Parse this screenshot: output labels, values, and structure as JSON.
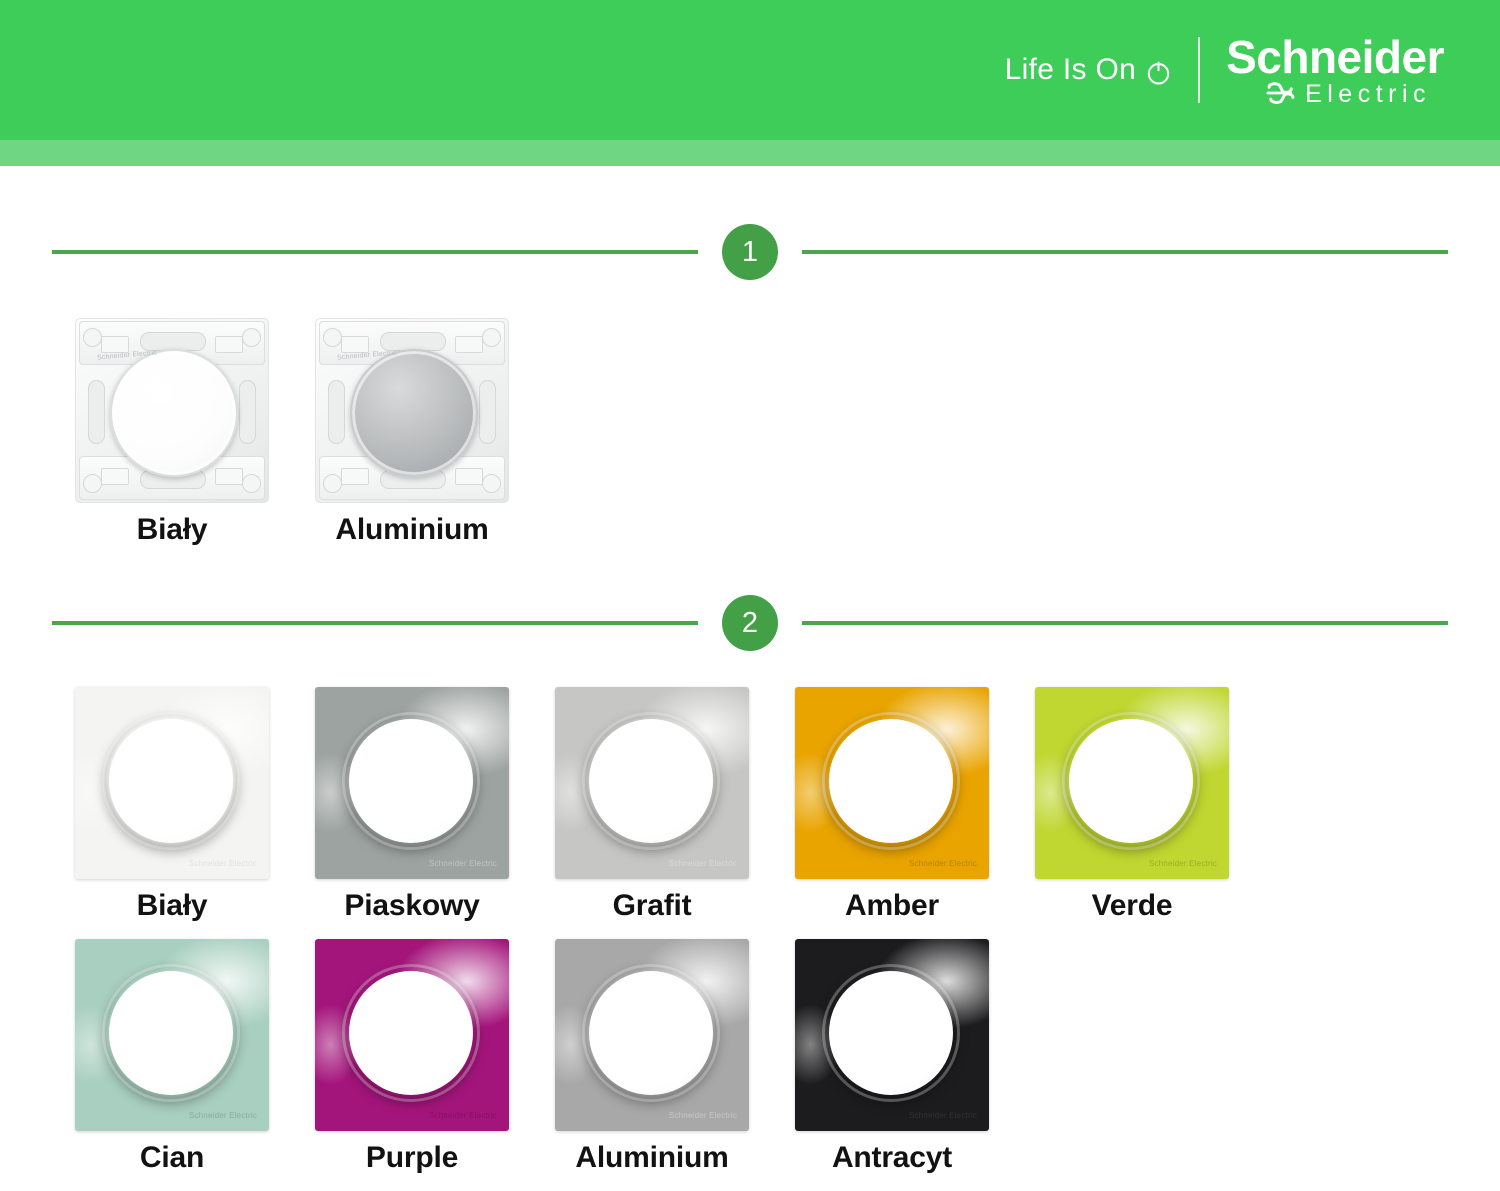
{
  "header": {
    "tagline": "Life Is On",
    "power_icon": "power-icon",
    "brand_name": "Schneider",
    "brand_sub": "Electric",
    "bg_color": "#3DCD58",
    "accent_color": "#6FD683"
  },
  "steps": [
    {
      "number": "1"
    },
    {
      "number": "2"
    }
  ],
  "section_one": {
    "items": [
      {
        "label": "Biały",
        "finish": "white",
        "brand_mark": "Schneider Electric"
      },
      {
        "label": "Aluminium",
        "finish": "alu",
        "brand_mark": "Schneider Electric"
      }
    ]
  },
  "section_two": {
    "items": [
      {
        "label": "Biały",
        "color": "#F4F4F2",
        "brand_color": "#c9cdc9",
        "brand_mark": "Schneider Electric"
      },
      {
        "label": "Piaskowy",
        "color": "#9DA3A1",
        "brand_color": "#e9eceb",
        "brand_mark": "Schneider Electric"
      },
      {
        "label": "Grafit",
        "color": "#C6C6C4",
        "brand_color": "#f0f1f0",
        "brand_mark": "Schneider Electric"
      },
      {
        "label": "Amber",
        "color": "#E9A400",
        "brand_color": "#7a5500",
        "brand_mark": "Schneider Electric"
      },
      {
        "label": "Verde",
        "color": "#BFD730",
        "brand_color": "#6d7d15",
        "brand_mark": "Schneider Electric"
      },
      {
        "label": "Cian",
        "color": "#A8CFC0",
        "brand_color": "#5d8374",
        "brand_mark": "Schneider Electric"
      },
      {
        "label": "Purple",
        "color": "#A4157C",
        "brand_color": "#5d0a47",
        "brand_mark": "Schneider Electric"
      },
      {
        "label": "Aluminium",
        "color": "#A8A8A8",
        "brand_color": "#ebebeb",
        "brand_mark": "Schneider Electric"
      },
      {
        "label": "Antracyt",
        "color": "#1C1C1E",
        "brand_color": "#4a4a4c",
        "brand_mark": "Schneider Electric"
      }
    ]
  }
}
